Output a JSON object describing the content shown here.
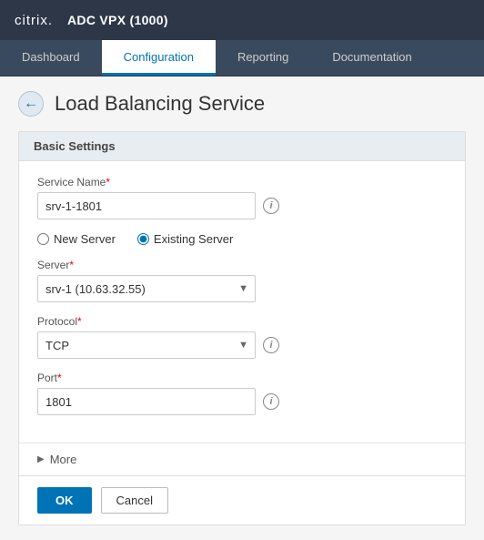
{
  "app": {
    "logo": "citrix.",
    "title": "ADC VPX (1000)"
  },
  "nav": {
    "tabs": [
      {
        "id": "dashboard",
        "label": "Dashboard",
        "active": false
      },
      {
        "id": "configuration",
        "label": "Configuration",
        "active": true
      },
      {
        "id": "reporting",
        "label": "Reporting",
        "active": false
      },
      {
        "id": "documentation",
        "label": "Documentation",
        "active": false
      }
    ]
  },
  "page": {
    "title": "Load Balancing Service",
    "back_label": "←"
  },
  "form": {
    "section_title": "Basic Settings",
    "service_name_label": "Service Name",
    "service_name_required": "*",
    "service_name_value": "srv-1-1801",
    "new_server_label": "New Server",
    "existing_server_label": "Existing Server",
    "server_label": "Server",
    "server_required": "*",
    "server_value": "srv-1 (10.63.32.55)",
    "protocol_label": "Protocol",
    "protocol_required": "*",
    "protocol_value": "TCP",
    "port_label": "Port",
    "port_required": "*",
    "port_value": "1801",
    "more_label": "More",
    "ok_label": "OK",
    "cancel_label": "Cancel",
    "info_icon": "i"
  }
}
